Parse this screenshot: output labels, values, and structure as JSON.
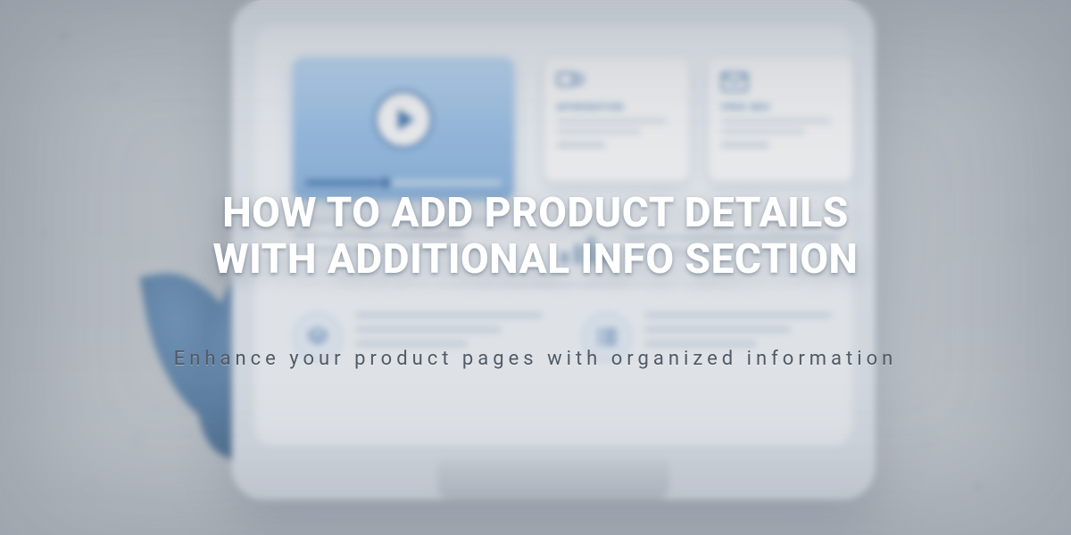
{
  "hero": {
    "title_line1": "HOW TO ADD PRODUCT DETAILS",
    "title_line2": "WITH ADDITIONAL INFO SECTION",
    "subtitle": "Enhance your product pages with organized information"
  },
  "cards": {
    "info": {
      "title": "APORINATION"
    },
    "inbox": {
      "title": "IFRIE INOI"
    }
  }
}
